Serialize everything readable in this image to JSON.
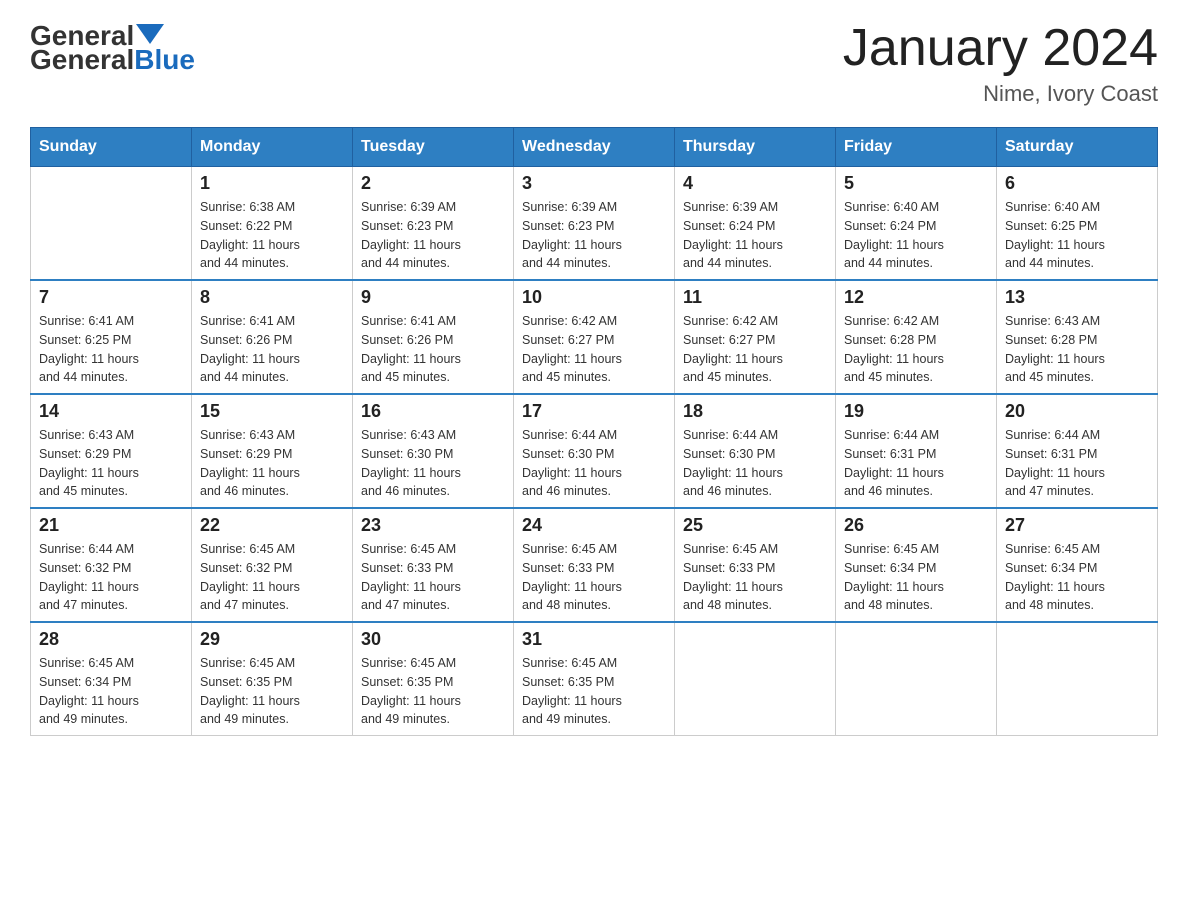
{
  "header": {
    "logo_general": "General",
    "logo_blue": "Blue",
    "month_title": "January 2024",
    "location": "Nime, Ivory Coast"
  },
  "weekdays": [
    "Sunday",
    "Monday",
    "Tuesday",
    "Wednesday",
    "Thursday",
    "Friday",
    "Saturday"
  ],
  "weeks": [
    [
      {
        "day": "",
        "info": ""
      },
      {
        "day": "1",
        "info": "Sunrise: 6:38 AM\nSunset: 6:22 PM\nDaylight: 11 hours\nand 44 minutes."
      },
      {
        "day": "2",
        "info": "Sunrise: 6:39 AM\nSunset: 6:23 PM\nDaylight: 11 hours\nand 44 minutes."
      },
      {
        "day": "3",
        "info": "Sunrise: 6:39 AM\nSunset: 6:23 PM\nDaylight: 11 hours\nand 44 minutes."
      },
      {
        "day": "4",
        "info": "Sunrise: 6:39 AM\nSunset: 6:24 PM\nDaylight: 11 hours\nand 44 minutes."
      },
      {
        "day": "5",
        "info": "Sunrise: 6:40 AM\nSunset: 6:24 PM\nDaylight: 11 hours\nand 44 minutes."
      },
      {
        "day": "6",
        "info": "Sunrise: 6:40 AM\nSunset: 6:25 PM\nDaylight: 11 hours\nand 44 minutes."
      }
    ],
    [
      {
        "day": "7",
        "info": "Sunrise: 6:41 AM\nSunset: 6:25 PM\nDaylight: 11 hours\nand 44 minutes."
      },
      {
        "day": "8",
        "info": "Sunrise: 6:41 AM\nSunset: 6:26 PM\nDaylight: 11 hours\nand 44 minutes."
      },
      {
        "day": "9",
        "info": "Sunrise: 6:41 AM\nSunset: 6:26 PM\nDaylight: 11 hours\nand 45 minutes."
      },
      {
        "day": "10",
        "info": "Sunrise: 6:42 AM\nSunset: 6:27 PM\nDaylight: 11 hours\nand 45 minutes."
      },
      {
        "day": "11",
        "info": "Sunrise: 6:42 AM\nSunset: 6:27 PM\nDaylight: 11 hours\nand 45 minutes."
      },
      {
        "day": "12",
        "info": "Sunrise: 6:42 AM\nSunset: 6:28 PM\nDaylight: 11 hours\nand 45 minutes."
      },
      {
        "day": "13",
        "info": "Sunrise: 6:43 AM\nSunset: 6:28 PM\nDaylight: 11 hours\nand 45 minutes."
      }
    ],
    [
      {
        "day": "14",
        "info": "Sunrise: 6:43 AM\nSunset: 6:29 PM\nDaylight: 11 hours\nand 45 minutes."
      },
      {
        "day": "15",
        "info": "Sunrise: 6:43 AM\nSunset: 6:29 PM\nDaylight: 11 hours\nand 46 minutes."
      },
      {
        "day": "16",
        "info": "Sunrise: 6:43 AM\nSunset: 6:30 PM\nDaylight: 11 hours\nand 46 minutes."
      },
      {
        "day": "17",
        "info": "Sunrise: 6:44 AM\nSunset: 6:30 PM\nDaylight: 11 hours\nand 46 minutes."
      },
      {
        "day": "18",
        "info": "Sunrise: 6:44 AM\nSunset: 6:30 PM\nDaylight: 11 hours\nand 46 minutes."
      },
      {
        "day": "19",
        "info": "Sunrise: 6:44 AM\nSunset: 6:31 PM\nDaylight: 11 hours\nand 46 minutes."
      },
      {
        "day": "20",
        "info": "Sunrise: 6:44 AM\nSunset: 6:31 PM\nDaylight: 11 hours\nand 47 minutes."
      }
    ],
    [
      {
        "day": "21",
        "info": "Sunrise: 6:44 AM\nSunset: 6:32 PM\nDaylight: 11 hours\nand 47 minutes."
      },
      {
        "day": "22",
        "info": "Sunrise: 6:45 AM\nSunset: 6:32 PM\nDaylight: 11 hours\nand 47 minutes."
      },
      {
        "day": "23",
        "info": "Sunrise: 6:45 AM\nSunset: 6:33 PM\nDaylight: 11 hours\nand 47 minutes."
      },
      {
        "day": "24",
        "info": "Sunrise: 6:45 AM\nSunset: 6:33 PM\nDaylight: 11 hours\nand 48 minutes."
      },
      {
        "day": "25",
        "info": "Sunrise: 6:45 AM\nSunset: 6:33 PM\nDaylight: 11 hours\nand 48 minutes."
      },
      {
        "day": "26",
        "info": "Sunrise: 6:45 AM\nSunset: 6:34 PM\nDaylight: 11 hours\nand 48 minutes."
      },
      {
        "day": "27",
        "info": "Sunrise: 6:45 AM\nSunset: 6:34 PM\nDaylight: 11 hours\nand 48 minutes."
      }
    ],
    [
      {
        "day": "28",
        "info": "Sunrise: 6:45 AM\nSunset: 6:34 PM\nDaylight: 11 hours\nand 49 minutes."
      },
      {
        "day": "29",
        "info": "Sunrise: 6:45 AM\nSunset: 6:35 PM\nDaylight: 11 hours\nand 49 minutes."
      },
      {
        "day": "30",
        "info": "Sunrise: 6:45 AM\nSunset: 6:35 PM\nDaylight: 11 hours\nand 49 minutes."
      },
      {
        "day": "31",
        "info": "Sunrise: 6:45 AM\nSunset: 6:35 PM\nDaylight: 11 hours\nand 49 minutes."
      },
      {
        "day": "",
        "info": ""
      },
      {
        "day": "",
        "info": ""
      },
      {
        "day": "",
        "info": ""
      }
    ]
  ]
}
